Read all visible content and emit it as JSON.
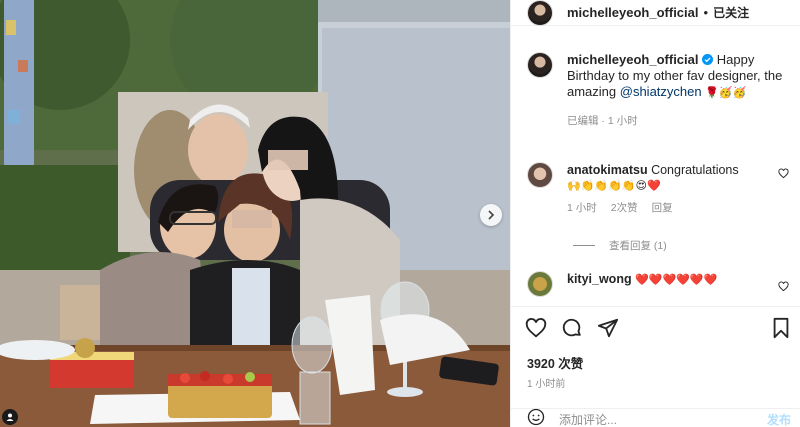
{
  "header": {
    "username": "michelleyeoh_official",
    "separator": "•",
    "follow_status": "已关注"
  },
  "caption": {
    "username": "michelleyeoh_official",
    "text_before": "Happy Birthday to my other fav designer, the amazing ",
    "mention": "@shiatzychen",
    "emojis": "🌹🥳🥳",
    "edited": "已编辑",
    "time": "1 小时"
  },
  "comments": [
    {
      "username": "anatokimatsu",
      "text": "Congratulations",
      "emojis": "🙌👏👏👏👏😍❤️",
      "time": "1 小时",
      "likes": "2次赞",
      "reply": "回复",
      "view_replies": "查看回复 (1)"
    },
    {
      "username": "kityi_wong",
      "emojis": "❤️❤️❤️❤️❤️❤️"
    }
  ],
  "actions": {
    "likes": "3920 次赞",
    "time": "1 小时前"
  },
  "add_comment": {
    "placeholder": "添加评论...",
    "post": "发布"
  },
  "icons": {
    "verified": "verified-badge-icon",
    "like": "heart-icon",
    "comment": "comment-bubble-icon",
    "share": "paper-plane-icon",
    "save": "bookmark-icon",
    "next": "chevron-right-icon",
    "emoji": "smiley-icon"
  },
  "colors": {
    "verified": "#0095f6",
    "mention": "#00376b",
    "secondary_text": "#8e8e8e",
    "post_disabled": "#b2dffc"
  }
}
